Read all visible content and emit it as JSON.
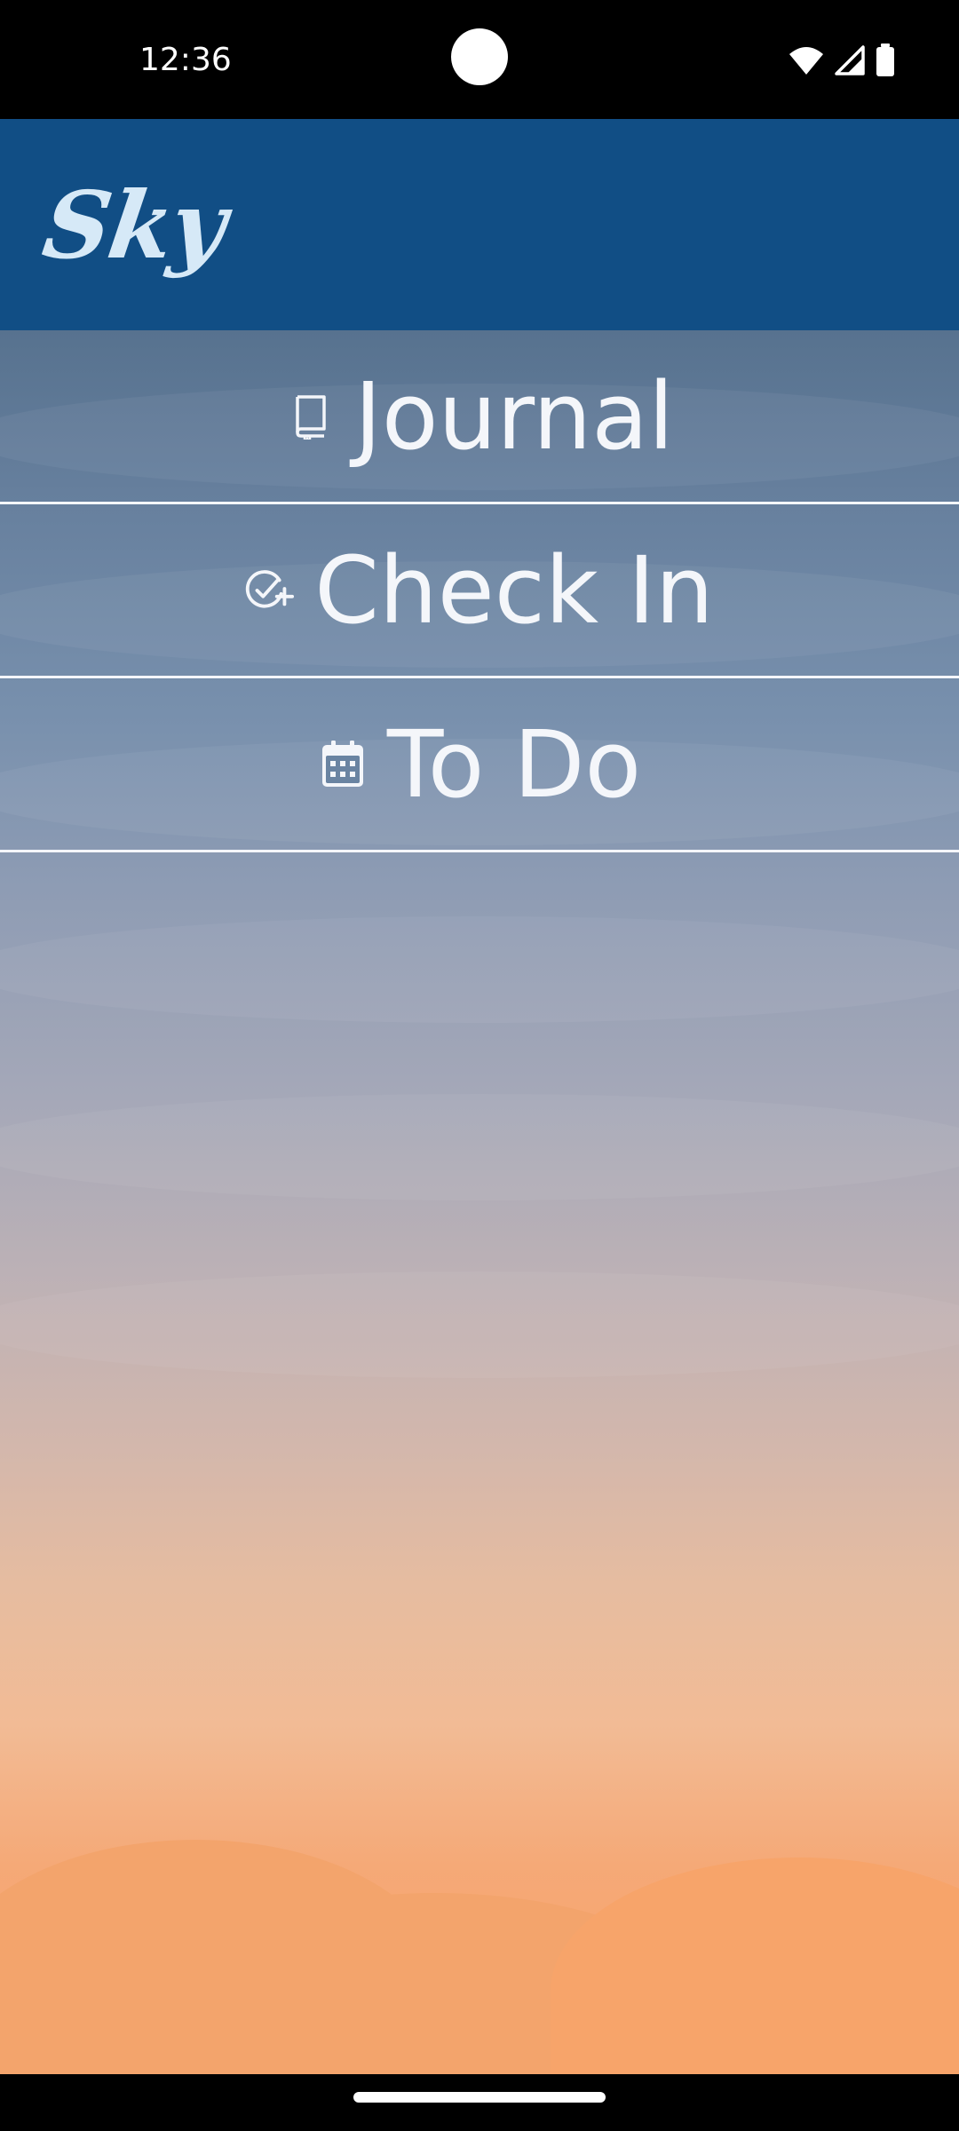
{
  "status_bar": {
    "time": "12:36",
    "icons": [
      "wifi-icon",
      "cell-signal-icon",
      "battery-icon"
    ]
  },
  "app_bar": {
    "logo_text": "Sky",
    "background_color": "#114e85",
    "logo_color": "#d6e9f7"
  },
  "menu": {
    "items": [
      {
        "label": "Journal",
        "icon": "book-icon"
      },
      {
        "label": "Check In",
        "icon": "check-circle-add-icon"
      },
      {
        "label": "To Do",
        "icon": "calendar-icon"
      }
    ]
  },
  "colors": {
    "sky_top": "#57728f",
    "sky_bottom": "#faa26a",
    "menu_text": "#f4f6fa"
  }
}
